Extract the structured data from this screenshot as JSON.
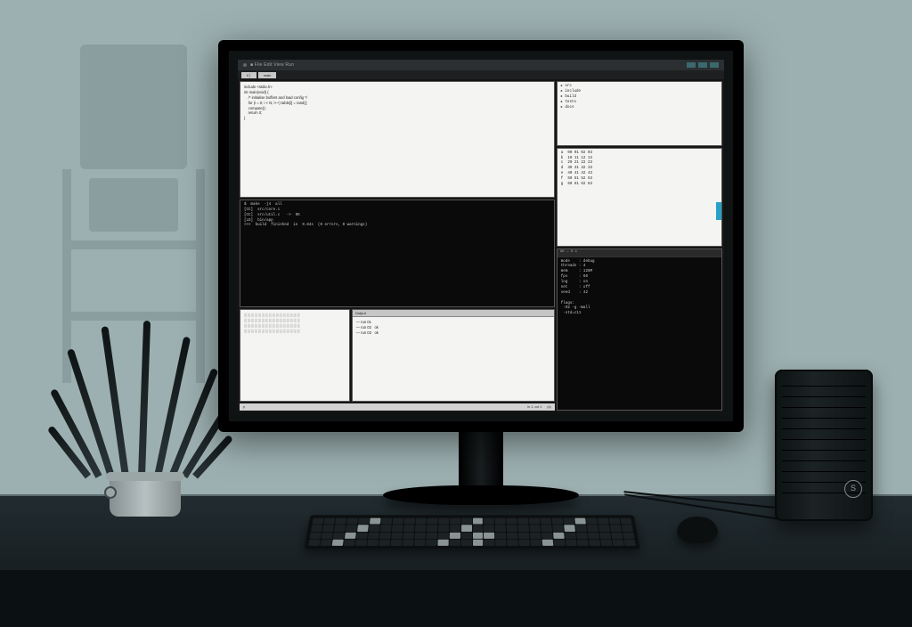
{
  "description": "Stylized illustration of a developer workstation: a black widescreen monitor on a desk showing a multi-pane IDE (light editor pane, dark terminal, side panels), with a keyboard, mouse, small PC tower to the right, and a potted plant to the left. Muted blue-grey wall with a faint equipment-rack shadow.",
  "monitor": {
    "titlebar": "■  File  Edit  View  Run",
    "tab1": "0│",
    "tab2": "main",
    "editor_lines": "include <stdio.h>\nint main(void) {\n    /* initialise buffers and load config */\n    for (i = 0; i < N; i++) table[i] = rand();\n    compute();\n    return 0;\n}",
    "terminal_lines": "$  make  -j4  all\n[CC]  src/core.c\n[CC]  src/util.c   ->  OK\n[LD]  bin/app\n>>>  build  finished  in  0.84s  (0 errors, 0 warnings)",
    "texture_note": "░░░░░░░░░░░░░░░░\n░░░░░░░░░░░░░░░░\n░░░░░░░░░░░░░░░░\n░░░░░░░░░░░░░░░░",
    "notes_hdr": "Output",
    "notes_body": "— run 01\n— run 02   ok\n— run 03   ok",
    "tree_body": "▸ src\n▸ include\n▸ build\n▸ tests\n▸ docs",
    "table_body": "a  00 01 02 03\nb  10 11 12 13\nc  20 21 22 23\nd  30 31 32 33\ne  40 41 42 43\nf  50 51 52 53\ng  60 61 62 63",
    "inspector_hdr": "GK — 0.1",
    "inspector_body": "mode    : debug\nthreads : 4\nmem     : 128M\nfps     : 60\nlog     : on\nnet     : off\nseed    : 42\n\nflags:\n -O2 -g -Wall\n -std=c11",
    "status_left": "p",
    "status_mid": "ln 1, col 1",
    "status_right": "(s)"
  },
  "tower": {
    "badge": "S"
  }
}
